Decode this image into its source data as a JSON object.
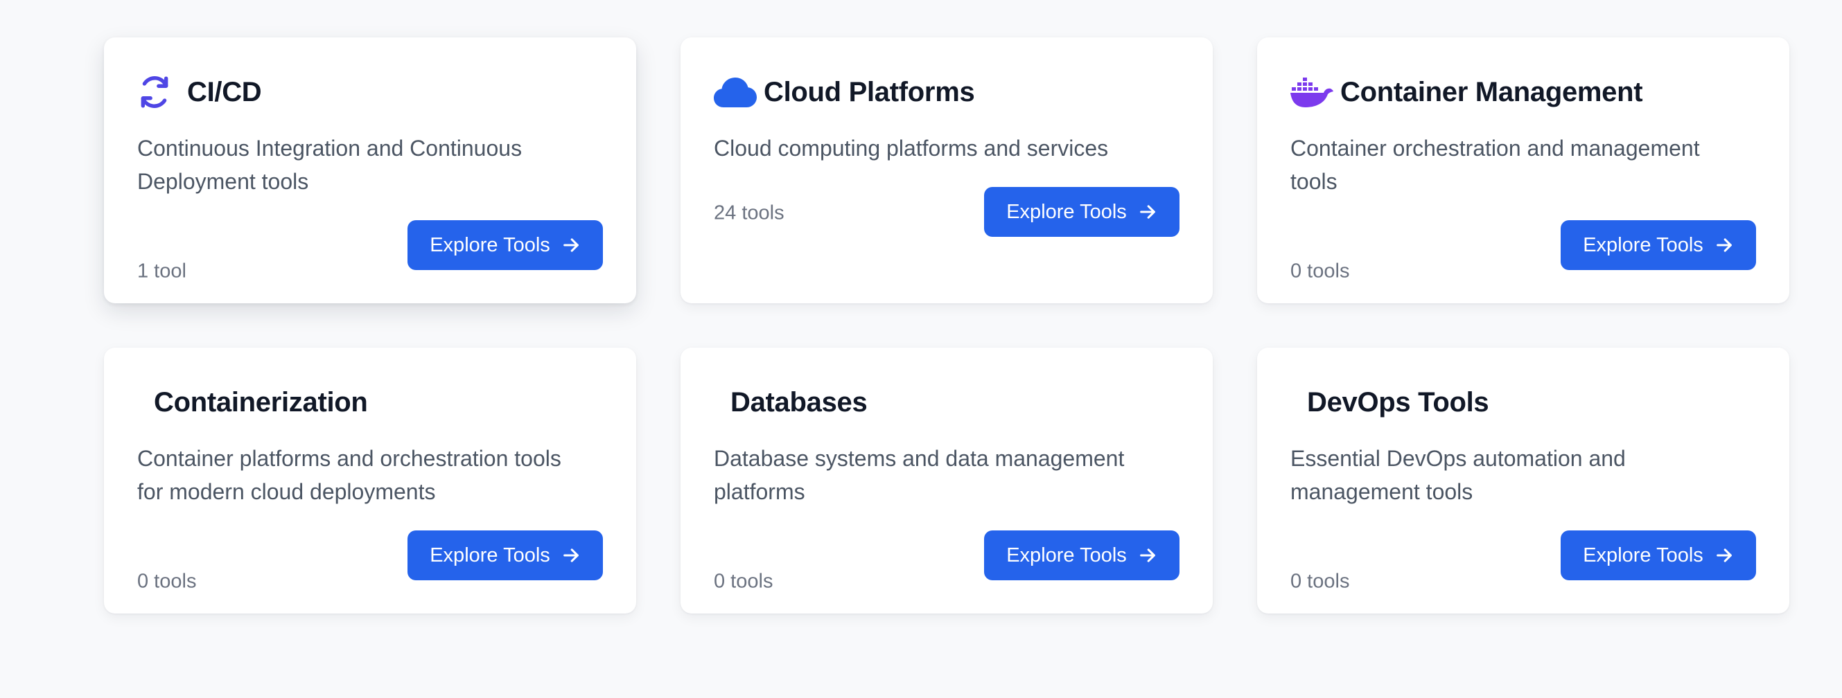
{
  "categories": [
    {
      "title": "CI/CD",
      "description": "Continuous Integration and Continuous Deployment tools",
      "count": "1 tool",
      "button": "Explore Tools",
      "icon": "sync-icon",
      "icon_color": "#4f46e5"
    },
    {
      "title": "Cloud Platforms",
      "description": "Cloud computing platforms and services",
      "count": "24 tools",
      "button": "Explore Tools",
      "icon": "cloud-icon",
      "icon_color": "#2563eb"
    },
    {
      "title": "Container Management",
      "description": "Container orchestration and management tools",
      "count": "0 tools",
      "button": "Explore Tools",
      "icon": "docker-icon",
      "icon_color": "#7c3aed"
    },
    {
      "title": "Containerization",
      "description": "Container platforms and orchestration tools for modern cloud deployments",
      "count": "0 tools",
      "button": "Explore Tools"
    },
    {
      "title": "Databases",
      "description": "Database systems and data management platforms",
      "count": "0 tools",
      "button": "Explore Tools"
    },
    {
      "title": "DevOps Tools",
      "description": "Essential DevOps automation and management tools",
      "count": "0 tools",
      "button": "Explore Tools"
    }
  ],
  "colors": {
    "primary_button": "#2563eb",
    "title_text": "#111827",
    "body_text": "#4b5563",
    "muted_text": "#6b7280",
    "page_background": "#f8f9fb"
  }
}
